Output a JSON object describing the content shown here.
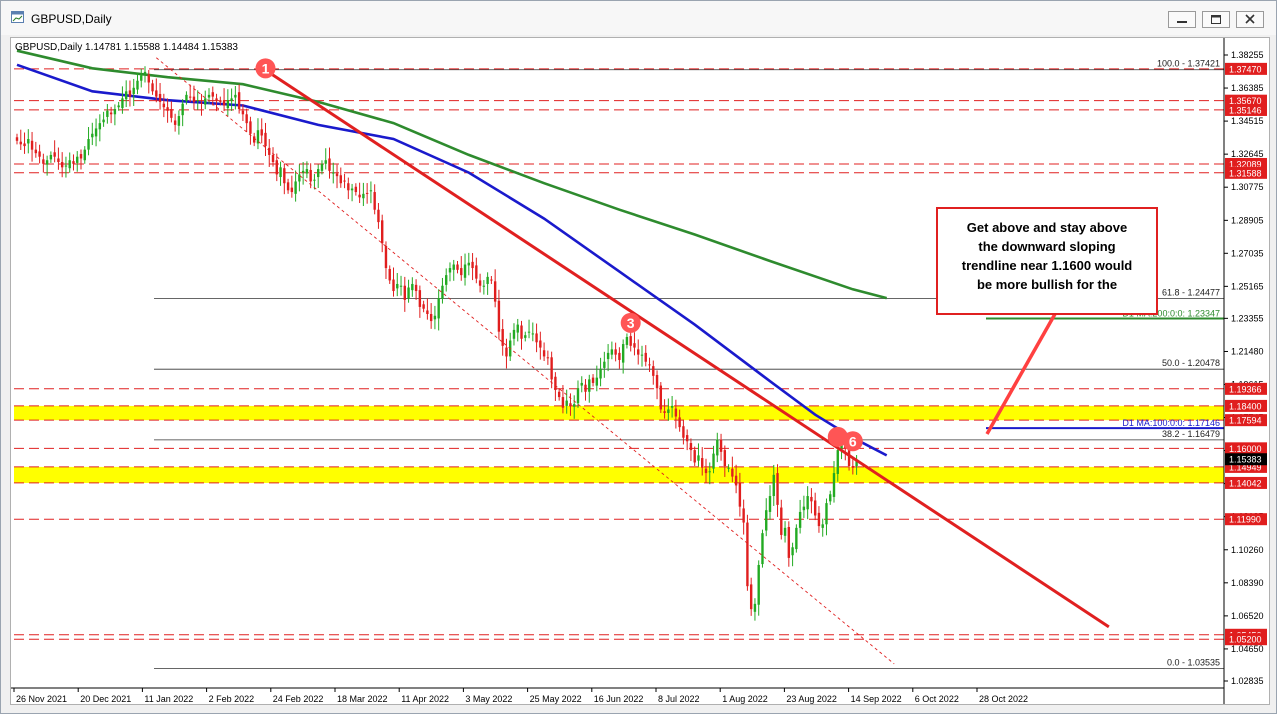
{
  "window": {
    "title": "GBPUSD,Daily"
  },
  "chart_data": {
    "type": "candlestick",
    "symbol_header": "GBPUSD,Daily  1.14781 1.15588 1.14484 1.15383",
    "price_axis": {
      "min": 1.01,
      "max": 1.3925,
      "ticks": [
        1.38255,
        1.36385,
        1.34515,
        1.32645,
        1.30775,
        1.289,
        1.27035,
        1.25165,
        1.23355,
        1.2148,
        1.19615,
        1.17745,
        1.15875,
        1.14005,
        1.12135,
        1.1026,
        1.0839,
        1.0652,
        1.0465,
        1.02835
      ],
      "tick_labels": [
        "1.38255",
        "1.36385",
        "1.34515",
        "1.32645",
        "1.30775",
        "1.28905",
        "1.27035",
        "1.25165",
        "1.23355",
        "1.21480",
        "1.19615",
        "1.17745",
        "1.15875",
        "1.14005",
        "1.12135",
        "1.10260",
        "1.08390",
        "1.06520",
        "1.04650",
        "1.02835"
      ]
    },
    "time_axis": {
      "labels": [
        "26 Nov 2021",
        "20 Dec 2021",
        "11 Jan 2022",
        "2 Feb 2022",
        "24 Feb 2022",
        "18 Mar 2022",
        "11 Apr 2022",
        "3 May 2022",
        "25 May 2022",
        "16 Jun 2022",
        "8 Jul 2022",
        "1 Aug 2022",
        "23 Aug 2022",
        "14 Sep 2022",
        "6 Oct 2022",
        "28 Oct 2022"
      ],
      "bar_range": [
        0,
        231
      ]
    },
    "closes": [
      1.334,
      1.332,
      1.331,
      1.335,
      1.329,
      1.327,
      1.325,
      1.321,
      1.323,
      1.326,
      1.325,
      1.322,
      1.319,
      1.32,
      1.323,
      1.321,
      1.325,
      1.324,
      1.329,
      1.335,
      1.338,
      1.341,
      1.344,
      1.346,
      1.351,
      1.349,
      1.352,
      1.354,
      1.358,
      1.362,
      1.359,
      1.364,
      1.368,
      1.371,
      1.373,
      1.367,
      1.362,
      1.359,
      1.356,
      1.353,
      1.351,
      1.347,
      1.343,
      1.348,
      1.355,
      1.36,
      1.359,
      1.356,
      1.357,
      1.355,
      1.358,
      1.36,
      1.359,
      1.357,
      1.356,
      1.354,
      1.357,
      1.358,
      1.36,
      1.352,
      1.349,
      1.344,
      1.338,
      1.333,
      1.34,
      1.337,
      1.331,
      1.326,
      1.322,
      1.315,
      1.319,
      1.31,
      1.306,
      1.305,
      1.311,
      1.315,
      1.317,
      1.318,
      1.311,
      1.312,
      1.318,
      1.321,
      1.323,
      1.317,
      1.316,
      1.314,
      1.31,
      1.311,
      1.306,
      1.307,
      1.305,
      1.302,
      1.304,
      1.304,
      1.306,
      1.295,
      1.288,
      1.276,
      1.262,
      1.255,
      1.249,
      1.253,
      1.252,
      1.244,
      1.251,
      1.253,
      1.249,
      1.24,
      1.239,
      1.236,
      1.232,
      1.235,
      1.245,
      1.252,
      1.258,
      1.262,
      1.264,
      1.261,
      1.258,
      1.264,
      1.265,
      1.262,
      1.256,
      1.252,
      1.252,
      1.257,
      1.255,
      1.243,
      1.226,
      1.218,
      1.212,
      1.221,
      1.227,
      1.23,
      1.222,
      1.224,
      1.226,
      1.225,
      1.22,
      1.217,
      1.212,
      1.211,
      1.199,
      1.193,
      1.189,
      1.183,
      1.187,
      1.184,
      1.185,
      1.194,
      1.197,
      1.192,
      1.199,
      1.197,
      1.2,
      1.205,
      1.209,
      1.214,
      1.216,
      1.213,
      1.21,
      1.219,
      1.223,
      1.218,
      1.217,
      1.213,
      1.213,
      1.209,
      1.207,
      1.201,
      1.194,
      1.182,
      1.18,
      1.182,
      1.184,
      1.178,
      1.172,
      1.166,
      1.164,
      1.159,
      1.152,
      1.156,
      1.149,
      1.146,
      1.147,
      1.157,
      1.165,
      1.158,
      1.15,
      1.149,
      1.144,
      1.139,
      1.127,
      1.118,
      1.082,
      1.069,
      1.072,
      1.094,
      1.112,
      1.125,
      1.133,
      1.145,
      1.128,
      1.111,
      1.115,
      1.098,
      1.104,
      1.115,
      1.124,
      1.127,
      1.133,
      1.13,
      1.122,
      1.116,
      1.117,
      1.129,
      1.134,
      1.146,
      1.159,
      1.163,
      1.16,
      1.15,
      1.149,
      1.153
    ],
    "moving_averages": [
      {
        "name": "D1 MA:100:0:0: 1.17146",
        "color": "#1a1acc",
        "points": [
          [
            0,
            1.377
          ],
          [
            20,
            1.362
          ],
          [
            40,
            1.357
          ],
          [
            60,
            1.354
          ],
          [
            80,
            1.343
          ],
          [
            100,
            1.335
          ],
          [
            120,
            1.316
          ],
          [
            140,
            1.29
          ],
          [
            160,
            1.26
          ],
          [
            180,
            1.23
          ],
          [
            200,
            1.198
          ],
          [
            212,
            1.179
          ],
          [
            222,
            1.166
          ],
          [
            231,
            1.156
          ]
        ]
      },
      {
        "name": "D1 MA:200:0:0: 1.23347",
        "color": "#2e8b2e",
        "points": [
          [
            0,
            1.385
          ],
          [
            20,
            1.375
          ],
          [
            40,
            1.37
          ],
          [
            60,
            1.366
          ],
          [
            80,
            1.356
          ],
          [
            100,
            1.344
          ],
          [
            120,
            1.326
          ],
          [
            140,
            1.31
          ],
          [
            160,
            1.295
          ],
          [
            180,
            1.281
          ],
          [
            200,
            1.266
          ],
          [
            222,
            1.25
          ],
          [
            231,
            1.245
          ]
        ]
      }
    ],
    "extension_values": {
      "ma100": 1.17146,
      "ma200": 1.23347
    },
    "trendlines": [
      {
        "name": "downward-trendline",
        "color": "#e02020",
        "from": [
          66,
          1.374
        ],
        "to": [
          290,
          1.059
        ]
      },
      {
        "name": "lower-channel-dotted",
        "color": "#e02020",
        "from": [
          37,
          1.381
        ],
        "to": [
          233,
          1.038
        ]
      }
    ],
    "fib_levels": [
      {
        "label": "100.0 - 1.37421",
        "value": 1.37421
      },
      {
        "label": "61.8 - 1.24477",
        "value": 1.24477
      },
      {
        "label": "50.0 - 1.20478",
        "value": 1.20478
      },
      {
        "label": "38.2 - 1.16479",
        "value": 1.16479
      },
      {
        "label": "0.0 - 1.03535",
        "value": 1.03535
      }
    ],
    "dashed_levels": [
      1.3747,
      1.3567,
      1.3515,
      1.3209,
      1.3159,
      1.1937,
      1.16,
      1.1199,
      1.0545,
      1.052
    ],
    "price_labels": [
      {
        "text": "1.37470",
        "value": 1.3747
      },
      {
        "text": "1.35670",
        "value": 1.3567
      },
      {
        "text": "1.35146",
        "value": 1.35146
      },
      {
        "text": "1.32089",
        "value": 1.32089
      },
      {
        "text": "1.31588",
        "value": 1.31588
      },
      {
        "text": "1.19366",
        "value": 1.19366
      },
      {
        "text": "1.18400",
        "value": 1.184
      },
      {
        "text": "1.17594",
        "value": 1.17594
      },
      {
        "text": "1.16000",
        "value": 1.16
      },
      {
        "text": "1.14949",
        "value": 1.14949
      },
      {
        "text": "1.14042",
        "value": 1.14042
      },
      {
        "text": "1.11990",
        "value": 1.1199
      },
      {
        "text": "1.05450",
        "value": 1.0545
      },
      {
        "text": "1.05200",
        "value": 1.052
      }
    ],
    "current_price": {
      "text": "1.15383",
      "value": 1.15383
    },
    "zones": [
      {
        "from": 1.17594,
        "to": 1.184,
        "color": "#ffff00"
      },
      {
        "from": 1.14042,
        "to": 1.14949,
        "color": "#ffff00"
      }
    ],
    "markers": [
      {
        "text": "1",
        "bar": 66,
        "value": 1.375
      },
      {
        "text": "3",
        "bar": 163,
        "value": 1.231
      },
      {
        "text": "",
        "bar": 218,
        "value": 1.1665
      },
      {
        "text": "6",
        "bar": 222,
        "value": 1.164
      }
    ],
    "annotation": {
      "text_lines": [
        "Get above and stay above",
        "the downward sloping",
        "trendline near 1.1600 would",
        "be more bullish for the"
      ]
    }
  }
}
